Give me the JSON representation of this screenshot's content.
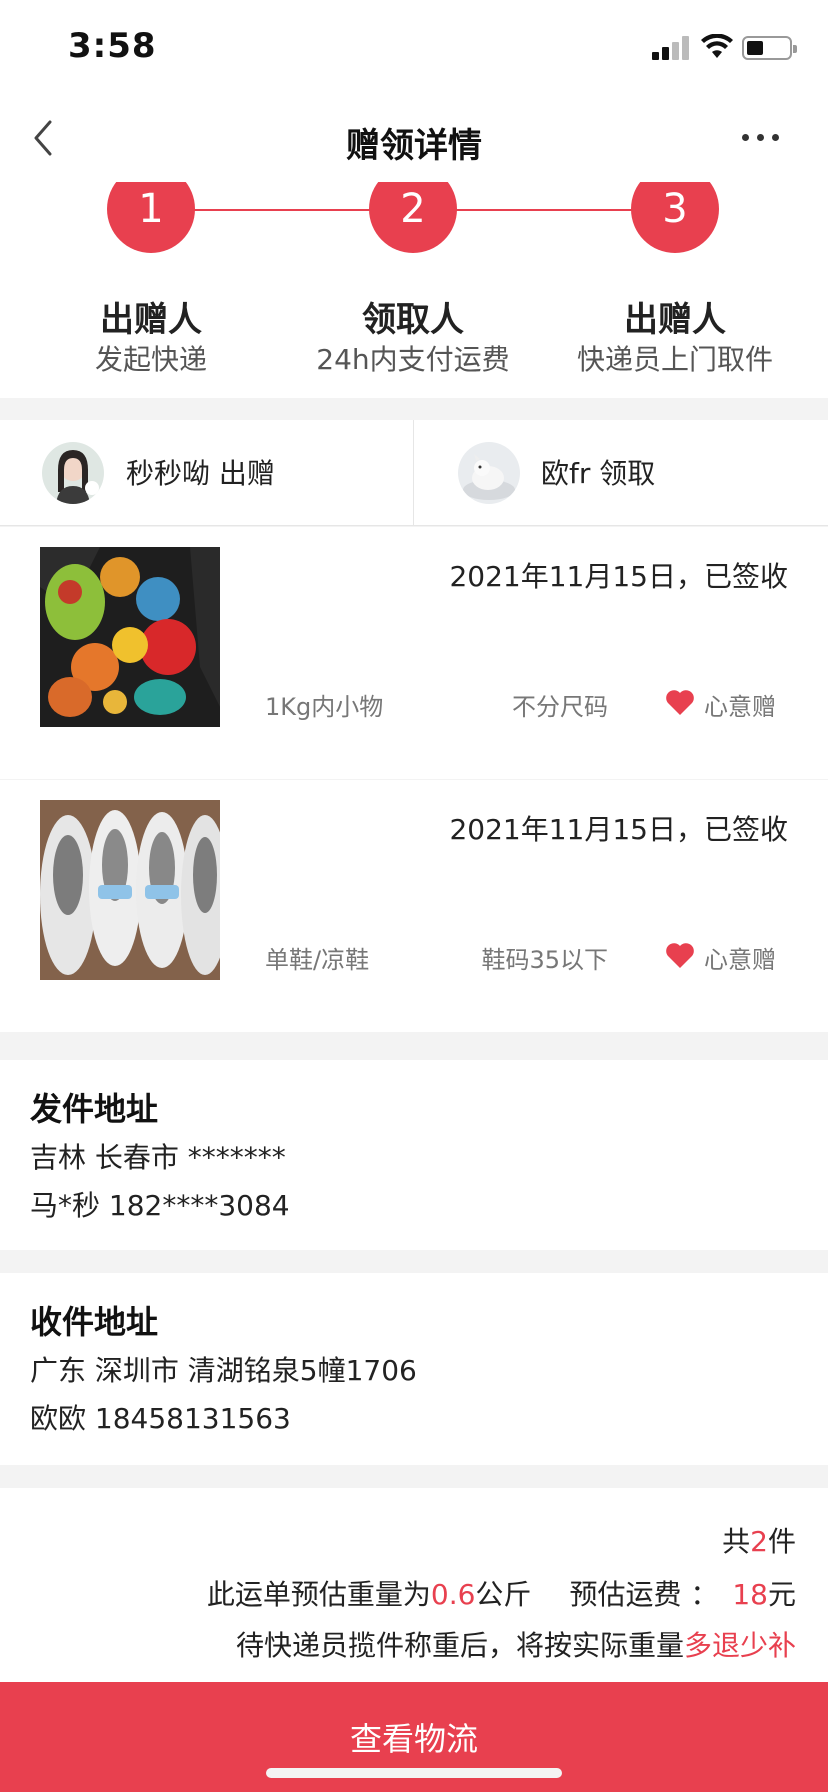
{
  "status_bar": {
    "time": "3:58"
  },
  "nav": {
    "title": "赠领详情"
  },
  "steps": [
    {
      "number": "1",
      "title": "出赠人",
      "subtitle": "发起快递"
    },
    {
      "number": "2",
      "title": "领取人",
      "subtitle": "24h内支付运费"
    },
    {
      "number": "3",
      "title": "出赠人",
      "subtitle": "快递员上门取件"
    }
  ],
  "people": {
    "giver": "秒秒呦 出赠",
    "receiver": "欧fr 领取"
  },
  "items": [
    {
      "date": "2021年11月15日，已签收",
      "category": "1Kg内小物",
      "size": "不分尺码",
      "gift_label": "心意赠"
    },
    {
      "date": "2021年11月15日，已签收",
      "category": "单鞋/凉鞋",
      "size": "鞋码35以下",
      "gift_label": "心意赠"
    }
  ],
  "sender": {
    "title": "发件地址",
    "region": "吉林 长春市 *******",
    "contact": "马*秒 182****3084"
  },
  "recipient": {
    "title": "收件地址",
    "region": "广东 深圳市 清湖铭泉5幢1706",
    "contact": "欧欧 18458131563"
  },
  "summary": {
    "count_prefix": "共",
    "count": "2",
    "count_suffix": "件",
    "weight_prefix": "此运单预估重量为",
    "weight": "0.6",
    "weight_unit": "公斤",
    "fee_label": "预估运费 ：",
    "fee": "18",
    "fee_unit": "元",
    "note_prefix": "待快递员揽件称重后，将按实际重量",
    "note_highlight": "多退少补"
  },
  "bottom_button": {
    "label": "查看物流"
  },
  "colors": {
    "accent": "#e8404f"
  }
}
